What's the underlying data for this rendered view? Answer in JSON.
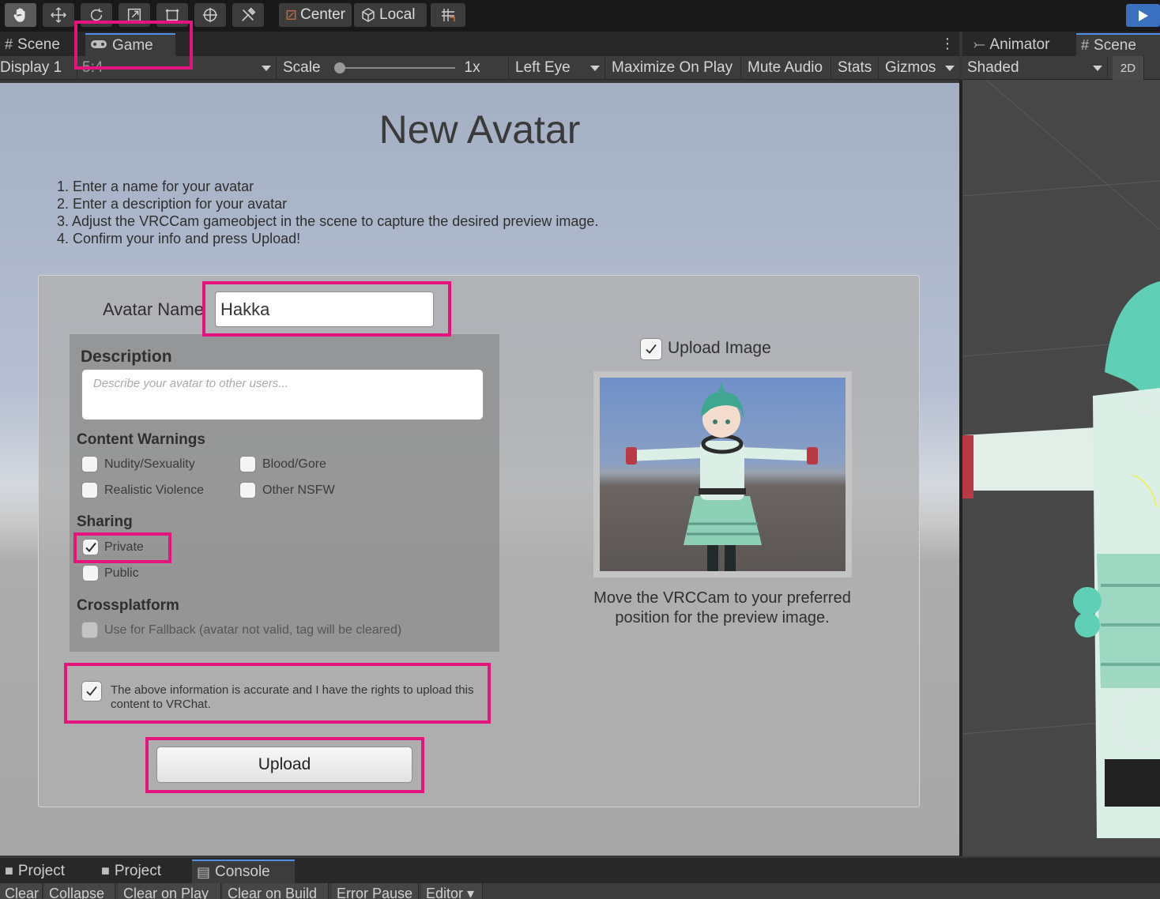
{
  "toolbar": {
    "tools": [
      "hand-tool-icon",
      "move-tool-icon",
      "rotate-tool-icon",
      "scale-tool-icon",
      "rect-tool-icon",
      "transform-tool-icon",
      "custom-tool-icon"
    ],
    "pivot_label": "Center",
    "space_label": "Local"
  },
  "left_tabs": {
    "scene": "Scene",
    "game": "Game"
  },
  "right_tabs": {
    "animator": "Animator",
    "scene": "Scene"
  },
  "game_toolbar": {
    "display": "Display 1",
    "aspect": "5:4",
    "scale_label": "Scale",
    "scale_value": "1x",
    "eye": "Left Eye",
    "maximize": "Maximize On Play",
    "mute": "Mute Audio",
    "stats": "Stats",
    "gizmos": "Gizmos"
  },
  "scene_toolbar": {
    "shading": "Shaded",
    "mode2d": "2D"
  },
  "form": {
    "title": "New Avatar",
    "steps": [
      "1. Enter a name for your avatar",
      "2. Enter a description for your avatar",
      "3. Adjust the VRCCam gameobject in the scene to capture the desired preview image.",
      "4. Confirm your info and press Upload!"
    ],
    "avatar_name_label": "Avatar Name",
    "avatar_name_value": "Hakka",
    "description_label": "Description",
    "description_placeholder": "Describe your avatar to other users...",
    "content_warnings_label": "Content Warnings",
    "warnings": {
      "nudity": "Nudity/Sexuality",
      "blood": "Blood/Gore",
      "violence": "Realistic Violence",
      "nsfw": "Other NSFW"
    },
    "sharing_label": "Sharing",
    "private_label": "Private",
    "public_label": "Public",
    "private_checked": true,
    "crossplatform_label": "Crossplatform",
    "fallback_label": "Use for Fallback (avatar not valid, tag will be cleared)",
    "upload_image_label": "Upload Image",
    "upload_image_checked": true,
    "move_hint": "Move the VRCCam to your preferred position for the preview image.",
    "agreement": "The above information is accurate and I have the rights to upload this content to VRChat.",
    "agreement_checked": true,
    "upload_button": "Upload"
  },
  "bottom_tabs": {
    "project1": "Project",
    "project2": "Project",
    "console": "Console"
  },
  "console_buttons": {
    "clear": "Clear",
    "collapse": "Collapse",
    "clear_on_play": "Clear on Play",
    "clear_on_build": "Clear on Build",
    "error_pause": "Error Pause",
    "editor": "Editor"
  },
  "colors": {
    "highlight": "#e5137d",
    "play": "#3b6fbf",
    "accent_tab": "#4f8ee8"
  }
}
